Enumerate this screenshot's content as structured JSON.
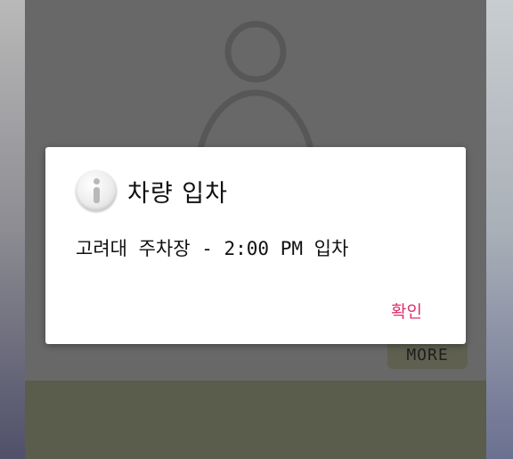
{
  "background": {
    "screen_color": "#686868",
    "bottom_panel_color": "#5a5c4c",
    "avatar_icon": "person-outline-icon"
  },
  "more_button": {
    "label": "MORE"
  },
  "dialog": {
    "icon": "info-icon",
    "title": "차량 입차",
    "message": "고려대 주차장 - 2:00 PM 입차",
    "confirm_label": "확인",
    "accent_color": "#e0306e"
  }
}
